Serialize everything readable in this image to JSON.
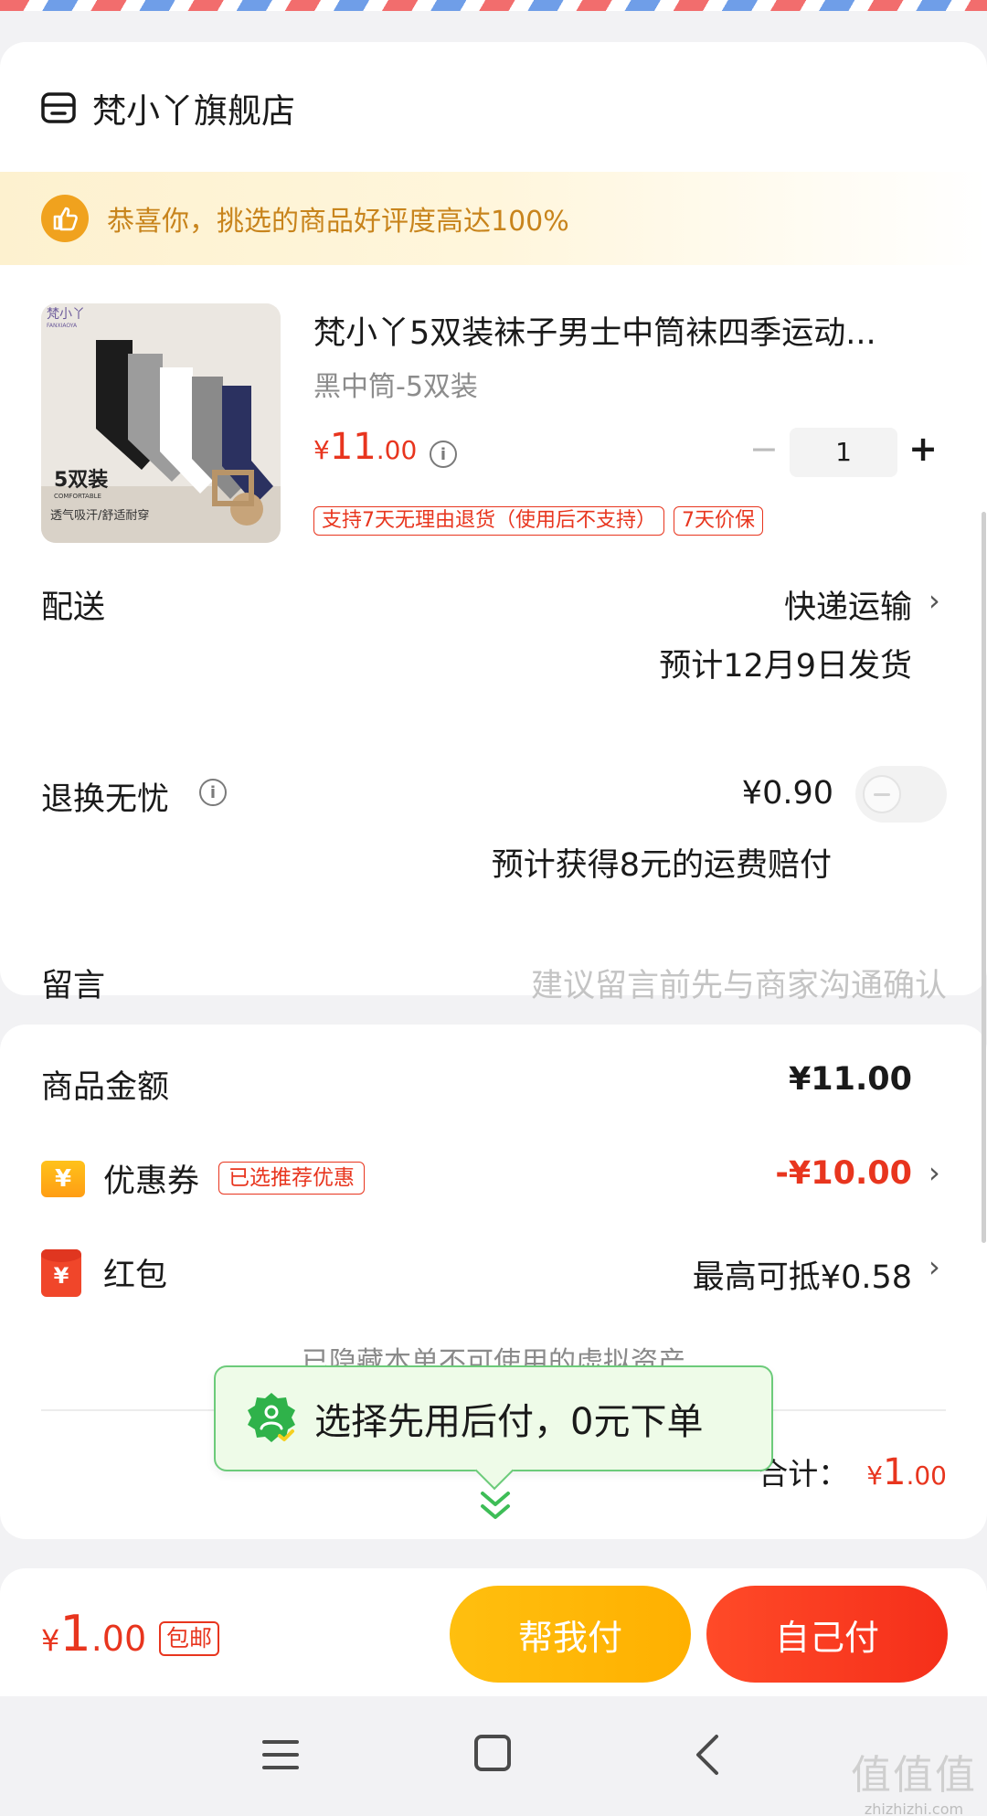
{
  "store": {
    "name": "梵小丫旗舰店"
  },
  "banner": {
    "text": "恭喜你，挑选的商品好评度高达100%"
  },
  "product": {
    "title": "梵小丫5双装袜子男士中筒袜四季运动...",
    "spec": "黑中筒-5双装",
    "price_currency": "¥",
    "price_int": "11",
    "price_dec": ".00",
    "quantity": "1",
    "tags": [
      "支持7天无理由退货（使用后不支持）",
      "7天价保"
    ],
    "image_text": {
      "brand": "梵小丫",
      "brand_en": "FANXIAOYA",
      "count": "5双装",
      "sub": "COMFORTABLE",
      "desc": "透气吸汗/舒适耐穿"
    }
  },
  "delivery": {
    "label": "配送",
    "method": "快递运输",
    "estimate": "预计12月9日发货"
  },
  "return_ins": {
    "label": "退换无忧",
    "price": "¥0.90",
    "note": "预计获得8元的运费赔付"
  },
  "message": {
    "label": "留言",
    "placeholder": "建议留言前先与商家沟通确认"
  },
  "summary": {
    "goods_label": "商品金额",
    "goods_amount": "¥11.00",
    "coupon_label": "优惠券",
    "coupon_tag": "已选推荐优惠",
    "coupon_amount": "-¥10.00",
    "redpack_label": "红包",
    "redpack_amount": "最高可抵¥0.58",
    "hidden_note": "已隐藏本单不可使用的虚拟资产",
    "total_label": "合计：",
    "total_currency": "¥",
    "total_int": "1",
    "total_dec": ".00"
  },
  "popup": {
    "text": "选择先用后付，0元下单"
  },
  "bottom": {
    "currency": "¥",
    "int": "1",
    "dec": ".00",
    "free_ship": "包邮",
    "help_pay": "帮我付",
    "self_pay": "自己付"
  },
  "watermark": {
    "main": "值值值",
    "sub": "zhizhizhi.com"
  },
  "colors": {
    "accent_red": "#e8351e",
    "accent_yellow": "#ffbf0f",
    "popup_green": "#6ccb7a"
  }
}
